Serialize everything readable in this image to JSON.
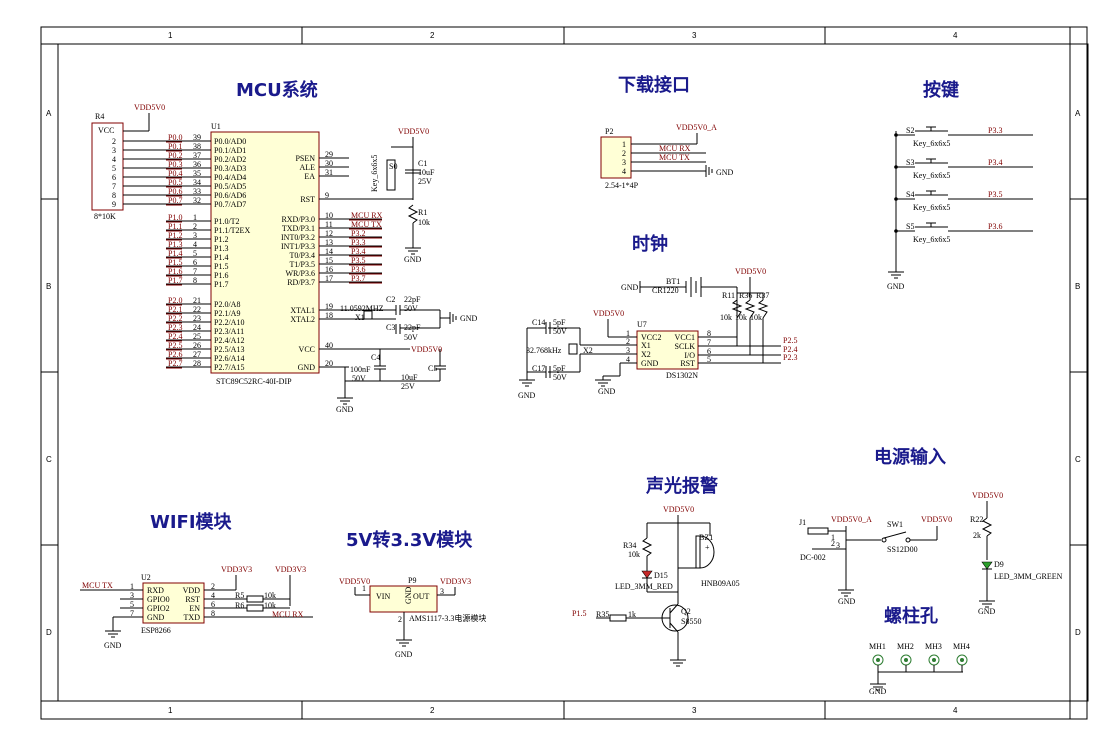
{
  "zones": {
    "cols": [
      "1",
      "2",
      "3",
      "4"
    ],
    "rows": [
      "A",
      "B",
      "C",
      "D"
    ]
  },
  "titles": {
    "mcu": "MCU系统",
    "download": "下载接口",
    "keys": "按键",
    "clock": "时钟",
    "power_in": "电源输入",
    "alarm": "声光报警",
    "wifi": "WIFI模块",
    "ldo": "5V转3.3V模块",
    "holes": "螺柱孔"
  },
  "mcu": {
    "ref": "U1",
    "part": "STC89C52RC-40I-DIP",
    "left_pins": [
      {
        "num": "39",
        "name": "P0.0/AD0",
        "net": "P0.0"
      },
      {
        "num": "38",
        "name": "P0.1/AD1",
        "net": "P0.1"
      },
      {
        "num": "37",
        "name": "P0.2/AD2",
        "net": "P0.2"
      },
      {
        "num": "36",
        "name": "P0.3/AD3",
        "net": "P0.3"
      },
      {
        "num": "35",
        "name": "P0.4/AD4",
        "net": "P0.4"
      },
      {
        "num": "34",
        "name": "P0.5/AD5",
        "net": "P0.5"
      },
      {
        "num": "33",
        "name": "P0.6/AD6",
        "net": "P0.6"
      },
      {
        "num": "32",
        "name": "P0.7/AD7",
        "net": "P0.7"
      },
      {
        "num": "1",
        "name": "P1.0/T2",
        "net": "P1.0"
      },
      {
        "num": "2",
        "name": "P1.1/T2EX",
        "net": "P1.1"
      },
      {
        "num": "3",
        "name": "P1.2",
        "net": "P1.2"
      },
      {
        "num": "4",
        "name": "P1.3",
        "net": "P1.3"
      },
      {
        "num": "5",
        "name": "P1.4",
        "net": "P1.4"
      },
      {
        "num": "6",
        "name": "P1.5",
        "net": "P1.5"
      },
      {
        "num": "7",
        "name": "P1.6",
        "net": "P1.6"
      },
      {
        "num": "8",
        "name": "P1.7",
        "net": "P1.7"
      },
      {
        "num": "21",
        "name": "P2.0/A8",
        "net": "P2.0"
      },
      {
        "num": "22",
        "name": "P2.1/A9",
        "net": "P2.1"
      },
      {
        "num": "23",
        "name": "P2.2/A10",
        "net": "P2.2"
      },
      {
        "num": "24",
        "name": "P2.3/A11",
        "net": "P2.3"
      },
      {
        "num": "25",
        "name": "P2.4/A12",
        "net": "P2.4"
      },
      {
        "num": "26",
        "name": "P2.5/A13",
        "net": "P2.5"
      },
      {
        "num": "27",
        "name": "P2.6/A14",
        "net": "P2.6"
      },
      {
        "num": "28",
        "name": "P2.7/A15",
        "net": "P2.7"
      }
    ],
    "right_pins": [
      {
        "num": "29",
        "name": "PSEN",
        "net": ""
      },
      {
        "num": "30",
        "name": "ALE",
        "net": ""
      },
      {
        "num": "31",
        "name": "EA",
        "net": ""
      },
      {
        "num": "9",
        "name": "RST",
        "net": ""
      },
      {
        "num": "10",
        "name": "RXD/P3.0",
        "net": "MCU RX"
      },
      {
        "num": "11",
        "name": "TXD/P3.1",
        "net": "MCU TX"
      },
      {
        "num": "12",
        "name": "INT0/P3.2",
        "net": "P3.2"
      },
      {
        "num": "13",
        "name": "INT1/P3.3",
        "net": "P3.3"
      },
      {
        "num": "14",
        "name": "T0/P3.4",
        "net": "P3.4"
      },
      {
        "num": "15",
        "name": "T1/P3.5",
        "net": "P3.5"
      },
      {
        "num": "16",
        "name": "WR/P3.6",
        "net": "P3.6"
      },
      {
        "num": "17",
        "name": "RD/P3.7",
        "net": "P3.7"
      },
      {
        "num": "19",
        "name": "XTAL1",
        "net": ""
      },
      {
        "num": "18",
        "name": "XTAL2",
        "net": ""
      },
      {
        "num": "40",
        "name": "VCC",
        "net": "VDD5V0"
      },
      {
        "num": "20",
        "name": "GND",
        "net": ""
      }
    ]
  },
  "r4": {
    "ref": "R4",
    "part": "8*10K",
    "vcc_label": "VCC",
    "pins": [
      "2",
      "3",
      "4",
      "5",
      "6",
      "7",
      "8",
      "9"
    ],
    "power": "VDD5V0"
  },
  "reset": {
    "power": "VDD5V0",
    "sw_ref": "S0",
    "sw_part": "Key_6x6x5",
    "c_ref": "C1",
    "c_val": "10uF",
    "c_v": "25V",
    "r_ref": "R1",
    "r_val": "10k",
    "gnd": "GND"
  },
  "xtal": {
    "ref": "X1",
    "val": "11.0592MHZ",
    "c2_ref": "C2",
    "c3_ref": "C3",
    "c_val": "22pF",
    "c_v": "50V",
    "gnd": "GND"
  },
  "decoup": {
    "c4_ref": "C4",
    "c4_val": "100nF",
    "c4_v": "50V",
    "c5_ref": "C5",
    "c5_val": "10uF",
    "c5_v": "25V",
    "gnd": "GND"
  },
  "download": {
    "ref": "P2",
    "part": "2.54-1*4P",
    "pins": [
      "1",
      "2",
      "3",
      "4"
    ],
    "nets": [
      "VDD5V0_A",
      "MCU RX",
      "MCU TX",
      "GND"
    ]
  },
  "keys": {
    "items": [
      {
        "ref": "S2",
        "part": "Key_6x6x5",
        "net": "P3.3"
      },
      {
        "ref": "S3",
        "part": "Key_6x6x5",
        "net": "P3.4"
      },
      {
        "ref": "S4",
        "part": "Key_6x6x5",
        "net": "P3.5"
      },
      {
        "ref": "S5",
        "part": "Key_6x6x5",
        "net": "P3.6"
      }
    ],
    "gnd": "GND"
  },
  "clock": {
    "bt_ref": "BT1",
    "bt_part": "CR1220",
    "gnd": "GND",
    "power": "VDD5V0",
    "u_ref": "U7",
    "u_part": "DS1302N",
    "left_pins": [
      {
        "num": "1",
        "name": "VCC2"
      },
      {
        "num": "2",
        "name": "X1"
      },
      {
        "num": "3",
        "name": "X2"
      },
      {
        "num": "4",
        "name": "GND"
      }
    ],
    "right_pins": [
      {
        "num": "8",
        "name": "VCC1"
      },
      {
        "num": "7",
        "name": "SCLK"
      },
      {
        "num": "6",
        "name": "I/O"
      },
      {
        "num": "5",
        "name": "RST"
      }
    ],
    "nets": [
      "P2.5",
      "P2.4",
      "P2.3"
    ],
    "resistors": [
      {
        "ref": "R11",
        "val": "10k"
      },
      {
        "ref": "R36",
        "val": "10k"
      },
      {
        "ref": "R37",
        "val": "10k"
      }
    ],
    "x2_ref": "X2",
    "x2_val": "32.768kHz",
    "c14_ref": "C14",
    "c17_ref": "C17",
    "c_val": "5pF",
    "c_v": "50V"
  },
  "power_in": {
    "j_ref": "J1",
    "j_part": "DC-002",
    "j_pins": [
      "1",
      "2",
      "3"
    ],
    "sw_ref": "SW1",
    "sw_part": "SS12D00",
    "net_a": "VDD5V0_A",
    "net_b": "VDD5V0",
    "gnd": "GND",
    "r_ref": "R22",
    "r_val": "2k",
    "d_ref": "D9",
    "d_part": "LED_3MM_GREEN",
    "power": "VDD5V0"
  },
  "alarm": {
    "power": "VDD5V0",
    "r34_ref": "R34",
    "r34_val": "10k",
    "d_ref": "D15",
    "d_part": "LED_3MM_RED",
    "bz_ref": "BZ1",
    "bz_part": "HNB09A05",
    "q_ref": "Q2",
    "q_part": "S8550",
    "r35_ref": "R35",
    "r35_val": "1k",
    "net": "P1.5"
  },
  "wifi": {
    "ref": "U2",
    "part": "ESP8266",
    "left_pins": [
      {
        "num": "1",
        "name": "RXD"
      },
      {
        "num": "3",
        "name": "GPIO0"
      },
      {
        "num": "5",
        "name": "GPIO2"
      },
      {
        "num": "7",
        "name": "GND"
      }
    ],
    "right_pins": [
      {
        "num": "2",
        "name": "VDD"
      },
      {
        "num": "4",
        "name": "RST"
      },
      {
        "num": "6",
        "name": "EN"
      },
      {
        "num": "8",
        "name": "TXD"
      }
    ],
    "net_tx": "MCU TX",
    "net_rx": "MCU RX",
    "power": "VDD3V3",
    "r5_ref": "R5",
    "r5_val": "10k",
    "r6_ref": "R6",
    "r6_val": "10k",
    "gnd": "GND"
  },
  "ldo": {
    "ref": "P9",
    "part": "AMS1117-3.3电源模块",
    "vin": "VIN",
    "gnd_pin": "GND",
    "out": "OUT",
    "in_net": "VDD5V0",
    "out_net": "VDD3V3",
    "pins": [
      "1",
      "2",
      "3"
    ],
    "gnd": "GND"
  },
  "holes": {
    "items": [
      "MH1",
      "MH2",
      "MH3",
      "MH4"
    ],
    "gnd": "GND"
  }
}
